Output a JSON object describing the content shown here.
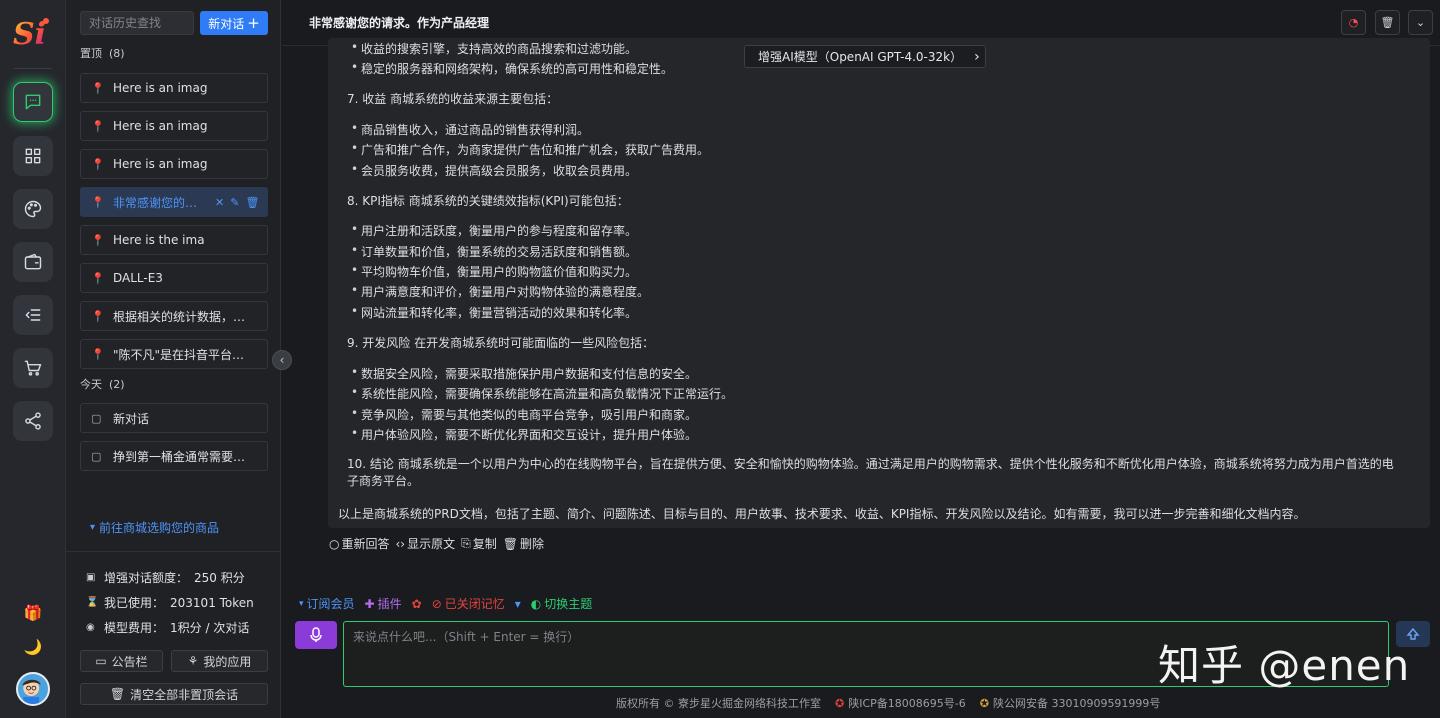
{
  "rail": {
    "logo_text": "Si",
    "buttons": [
      "chat-icon",
      "apps-grid-icon",
      "palette-icon",
      "wallet-icon",
      "menu-list-icon",
      "cart-icon",
      "share-icon"
    ]
  },
  "sidebar": {
    "search_placeholder": "对话历史查找",
    "new_chat_label": "新对话",
    "pinned_label": "置顶",
    "pinned_count": "(8)",
    "pinned": [
      {
        "title": "Here is an imag"
      },
      {
        "title": "Here is an imag"
      },
      {
        "title": "Here is an imag"
      },
      {
        "title": "非常感谢您的请..."
      },
      {
        "title": "Here is the ima"
      },
      {
        "title": "DALL-E3"
      },
      {
        "title": "根据相关的统计数据，以..."
      },
      {
        "title": "\"陈不凡\"是在抖音平台上..."
      }
    ],
    "today_label": "今天",
    "today_count": "(2)",
    "today": [
      {
        "title": "新对话"
      },
      {
        "title": "挣到第一桶金通常需要一..."
      }
    ],
    "shop_link": "前往商城选购您的商品",
    "stats": {
      "quota_label": "增强对话额度：",
      "quota_value": "250 积分",
      "used_label": "我已使用：",
      "used_value": "203101 Token",
      "fee_label": "模型费用：",
      "fee_value": "1积分 / 次对话"
    },
    "notice_button": "公告栏",
    "my_apps_button": "我的应用",
    "clear_button": "清空全部非置顶会话"
  },
  "topbar": {
    "title": "非常感谢您的请求。作为产品经理"
  },
  "model_pill": "增强AI模型（OpenAI GPT-4.0-32k）",
  "message": {
    "lines": [
      {
        "t": "收益的搜索引擎，支持高效的商品搜索和过滤功能。",
        "k": "bul"
      },
      {
        "t": "稳定的服务器和网络架构，确保系统的高可用性和稳定性。",
        "k": "bul"
      },
      {
        "t": "7. 收益 商城系统的收益来源主要包括：",
        "k": "num"
      },
      {
        "t": "商品销售收入，通过商品的销售获得利润。",
        "k": "bul"
      },
      {
        "t": "广告和推广合作，为商家提供广告位和推广机会，获取广告费用。",
        "k": "bul"
      },
      {
        "t": "会员服务收费，提供高级会员服务，收取会员费用。",
        "k": "bul"
      },
      {
        "t": "8. KPI指标 商城系统的关键绩效指标(KPI)可能包括：",
        "k": "num"
      },
      {
        "t": "用户注册和活跃度，衡量用户的参与程度和留存率。",
        "k": "bul"
      },
      {
        "t": "订单数量和价值，衡量系统的交易活跃度和销售额。",
        "k": "bul"
      },
      {
        "t": "平均购物车价值，衡量用户的购物篮价值和购买力。",
        "k": "bul"
      },
      {
        "t": "用户满意度和评价，衡量用户对购物体验的满意程度。",
        "k": "bul"
      },
      {
        "t": "网站流量和转化率，衡量营销活动的效果和转化率。",
        "k": "bul"
      },
      {
        "t": "9. 开发风险 在开发商城系统时可能面临的一些风险包括：",
        "k": "num"
      },
      {
        "t": "数据安全风险，需要采取措施保护用户数据和支付信息的安全。",
        "k": "bul"
      },
      {
        "t": "系统性能风险，需要确保系统能够在高流量和高负载情况下正常运行。",
        "k": "bul"
      },
      {
        "t": "竞争风险，需要与其他类似的电商平台竞争，吸引用户和商家。",
        "k": "bul"
      },
      {
        "t": "用户体验风险，需要不断优化界面和交互设计，提升用户体验。",
        "k": "bul"
      },
      {
        "t": "10. 结论 商城系统是一个以用户为中心的在线购物平台，旨在提供方便、安全和愉快的购物体验。通过满足用户的购物需求、提供个性化服务和不断优化用户体验，商城系统将努力成为用户首选的电子商务平台。",
        "k": "num wrap"
      },
      {
        "t": "以上是商城系统的PRD文档，包括了主题、简介、问题陈述、目标与目的、用户故事、技术要求、收益、KPI指标、开发风险以及结论。如有需要，我可以进一步完善和细化文档内容。",
        "k": "plain"
      }
    ]
  },
  "actions": {
    "regenerate": "重新回答",
    "show_raw": "显示原文",
    "copy": "复制",
    "delete": "删除"
  },
  "toolbar": {
    "subscribe": "订阅会员",
    "plugins": "插件",
    "memory_off": "已关闭记忆",
    "switch_theme": "切换主题"
  },
  "input": {
    "placeholder": "来说点什么吧...（Shift + Enter = 换行）"
  },
  "watermark": "知乎 @enen",
  "footer": {
    "copyright": "版权所有 © 寮步星火掘金网络科技工作室",
    "icp": "陕ICP备18008695号-6",
    "police": "陕公网安备 33010909591999号"
  },
  "colors": {
    "accent": "#2f7cf6",
    "active_green": "#2ecc71",
    "mic_purple": "#8a3bd8"
  }
}
